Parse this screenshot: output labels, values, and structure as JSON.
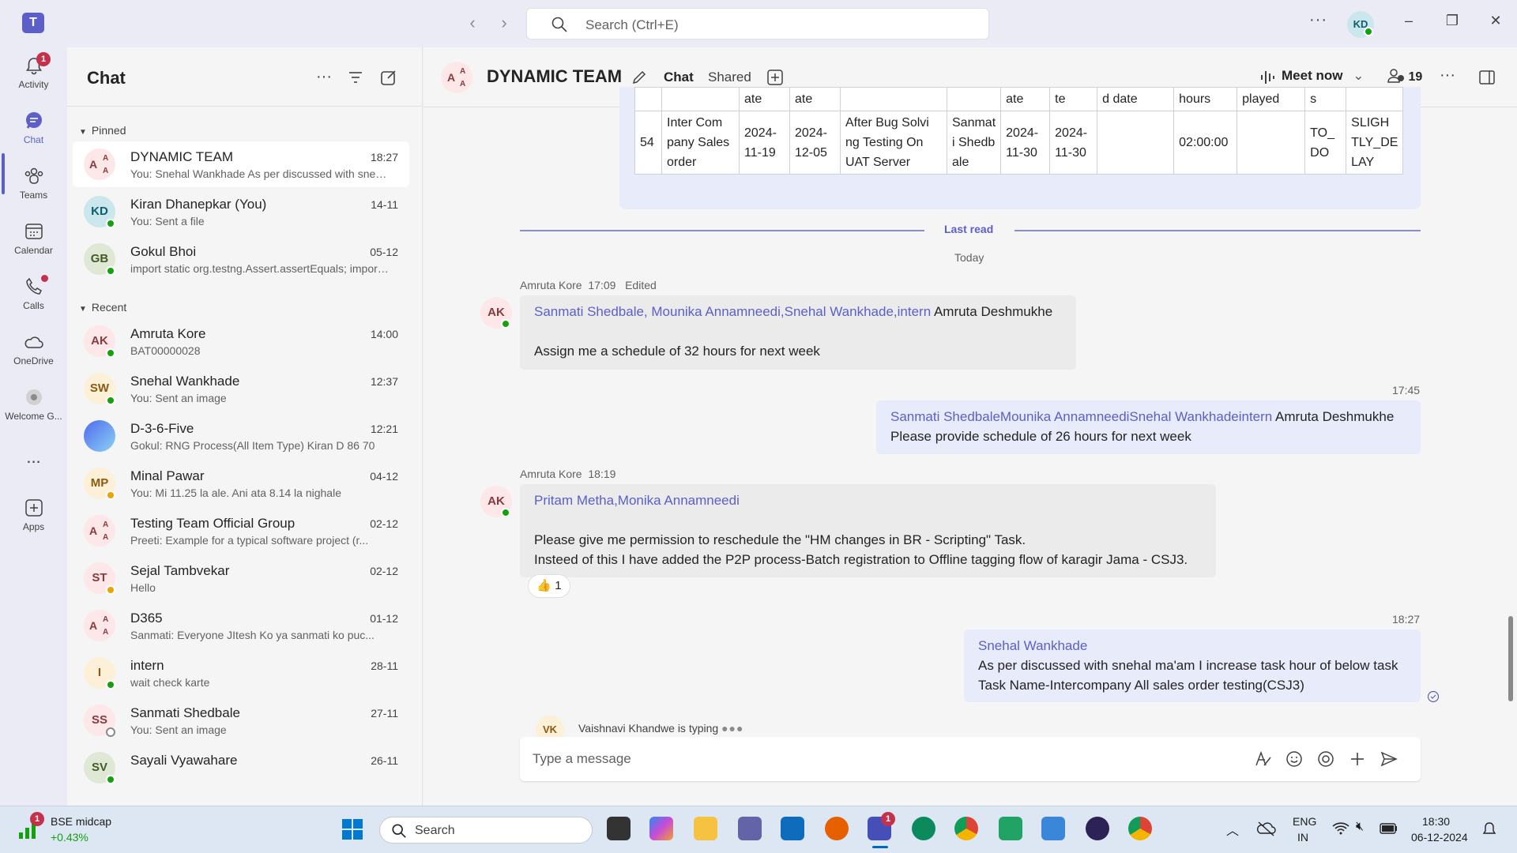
{
  "titlebar": {
    "search_placeholder": "Search (Ctrl+E)",
    "avatar": "KD"
  },
  "rail": [
    {
      "label": "Activity",
      "icon": "bell-icon",
      "badge": "1"
    },
    {
      "label": "Chat",
      "icon": "chat-icon",
      "active": true
    },
    {
      "label": "Teams",
      "icon": "teams-icon"
    },
    {
      "label": "Calendar",
      "icon": "calendar-icon"
    },
    {
      "label": "Calls",
      "icon": "phone-icon"
    },
    {
      "label": "OneDrive",
      "icon": "cloud-icon"
    },
    {
      "label": "Welcome G...",
      "icon": "welcome-icon"
    },
    {
      "label": "...",
      "icon": "more-icon"
    },
    {
      "label": "Apps",
      "icon": "apps-icon"
    }
  ],
  "chatlist": {
    "title": "Chat",
    "pinned_label": "Pinned",
    "recent_label": "Recent",
    "pinned": [
      {
        "initials": "A",
        "name": "DYNAMIC TEAM",
        "time": "18:27",
        "preview": "You: Snehal Wankhade As per discussed with snehal ma'am I increase task hour of below task",
        "group": true,
        "selected": true
      },
      {
        "initials": "KD",
        "name": "Kiran Dhanepkar (You)",
        "time": "14-11",
        "preview": "You: Sent a file",
        "color": "#c9e7ec",
        "fg": "#0f5e6e",
        "status": "online"
      },
      {
        "initials": "GB",
        "name": "Gokul Bhoi",
        "time": "05-12",
        "preview": "import static org.testng.Assert.assertEquals;   import static",
        "color": "#dfe8d5",
        "fg": "#405b26",
        "status": "online"
      }
    ],
    "recent": [
      {
        "initials": "AK",
        "name": "Amruta Kore",
        "time": "14:00",
        "preview": "BAT00000028",
        "color": "#fde7e9",
        "fg": "#8a3a3a",
        "status": "online"
      },
      {
        "initials": "SW",
        "name": "Snehal Wankhade",
        "time": "12:37",
        "preview": "You: Sent an image",
        "color": "#fdf0d8",
        "fg": "#8a5a10",
        "status": "online"
      },
      {
        "initials": "",
        "name": "D-3-6-Five",
        "time": "12:21",
        "preview": "Gokul: RNG Process(All Item Type) Kiran D 86 70",
        "color": "#cfd8f5",
        "fg": "#2b3f8c",
        "image": true
      },
      {
        "initials": "MP",
        "name": "Minal Pawar",
        "time": "04-12",
        "preview": "You: Mi 11.25 la ale. Ani ata 8.14 la nighale",
        "color": "#fdf0d8",
        "fg": "#8a5a10",
        "status": "away"
      },
      {
        "initials": "A",
        "name": "Testing Team Official Group",
        "time": "02-12",
        "preview": "Preeti: Example for a typical software project (r...",
        "group": true
      },
      {
        "initials": "ST",
        "name": "Sejal Tambvekar",
        "time": "02-12",
        "preview": "Hello",
        "color": "#fde7e9",
        "fg": "#8a3a3a",
        "status": "away"
      },
      {
        "initials": "A",
        "name": "D365",
        "time": "01-12",
        "preview": "Sanmati: Everyone JItesh Ko ya sanmati ko puc...",
        "group": true
      },
      {
        "initials": "I",
        "name": "intern",
        "time": "28-11",
        "preview": "wait check karte",
        "color": "#fdf0d8",
        "fg": "#8a5a10",
        "status": "online"
      },
      {
        "initials": "SS",
        "name": "Sanmati Shedbale",
        "time": "27-11",
        "preview": "You: Sent an image",
        "color": "#fde7e9",
        "fg": "#8a3a3a",
        "status": "off"
      },
      {
        "initials": "SV",
        "name": "Sayali Vyawahare",
        "time": "26-11",
        "preview": "",
        "color": "#dfe8d5",
        "fg": "#405b26",
        "status": "online"
      }
    ]
  },
  "header": {
    "title": "DYNAMIC TEAM",
    "tabs": [
      "Chat",
      "Shared"
    ],
    "meet_label": "Meet now",
    "participants": "19"
  },
  "table": {
    "header_row": [
      "",
      "",
      "ate",
      "ate",
      "",
      "",
      "ate",
      "te",
      "d date",
      "hours",
      "played",
      "s",
      ""
    ],
    "row": [
      "54",
      "Inter Com pany Sales order",
      "2024-11-19",
      "2024-12-05",
      "After Bug Solvi ng Testing On UAT Server",
      "Sanmat i Shedb ale",
      "2024-11-30",
      "2024-11-30",
      "",
      "02:00:00",
      "",
      "TO_ DO",
      "SLIGH TLY_DE LAY"
    ]
  },
  "divider": {
    "last_read": "Last read",
    "today": "Today"
  },
  "messages": {
    "m1": {
      "author": "Amruta Kore",
      "time": "17:09",
      "edited": "Edited",
      "avatar": "AK",
      "mentions": "Sanmati Shedbale, Mounika Annamneedi,Snehal Wankhade,intern",
      "mention_tail": " Amruta Deshmukhe",
      "body": "Assign me a schedule of 32 hours for next week"
    },
    "m2": {
      "time": "17:45",
      "mentions": "Sanmati ShedbaleMounika AnnamneediSnehal Wankhadeintern",
      "mention_tail": " Amruta Deshmukhe",
      "body": "Please provide schedule of 26 hours for next week"
    },
    "m3": {
      "author": "Amruta Kore",
      "time": "18:19",
      "avatar": "AK",
      "mentions": "Pritam Metha,Monika Annamneedi",
      "line1": "Please give me permission to reschedule the \"HM changes in BR - Scripting\" Task.",
      "line2": "Insteed of this I have added the P2P process-Batch registration to Offline tagging flow of karagir Jama - CSJ3.",
      "reaction": "👍",
      "reaction_count": "1"
    },
    "m4": {
      "time": "18:27",
      "mentions": "Snehal Wankhade",
      "line1": "As per discussed with snehal ma'am I increase task hour of below task",
      "line2": "Task Name-Intercompany All sales order testing(CSJ3)"
    }
  },
  "typing": {
    "avatar": "VK",
    "text": "Vaishnavi Khandwe is typing"
  },
  "composer": {
    "placeholder": "Type a message"
  },
  "taskbar": {
    "widget_name": "BSE midcap",
    "widget_value": "+0.43%",
    "widget_badge": "1",
    "search_label": "Search",
    "teams_badge": "1",
    "lang1": "ENG",
    "lang2": "IN",
    "time": "18:30",
    "date": "06-12-2024"
  }
}
